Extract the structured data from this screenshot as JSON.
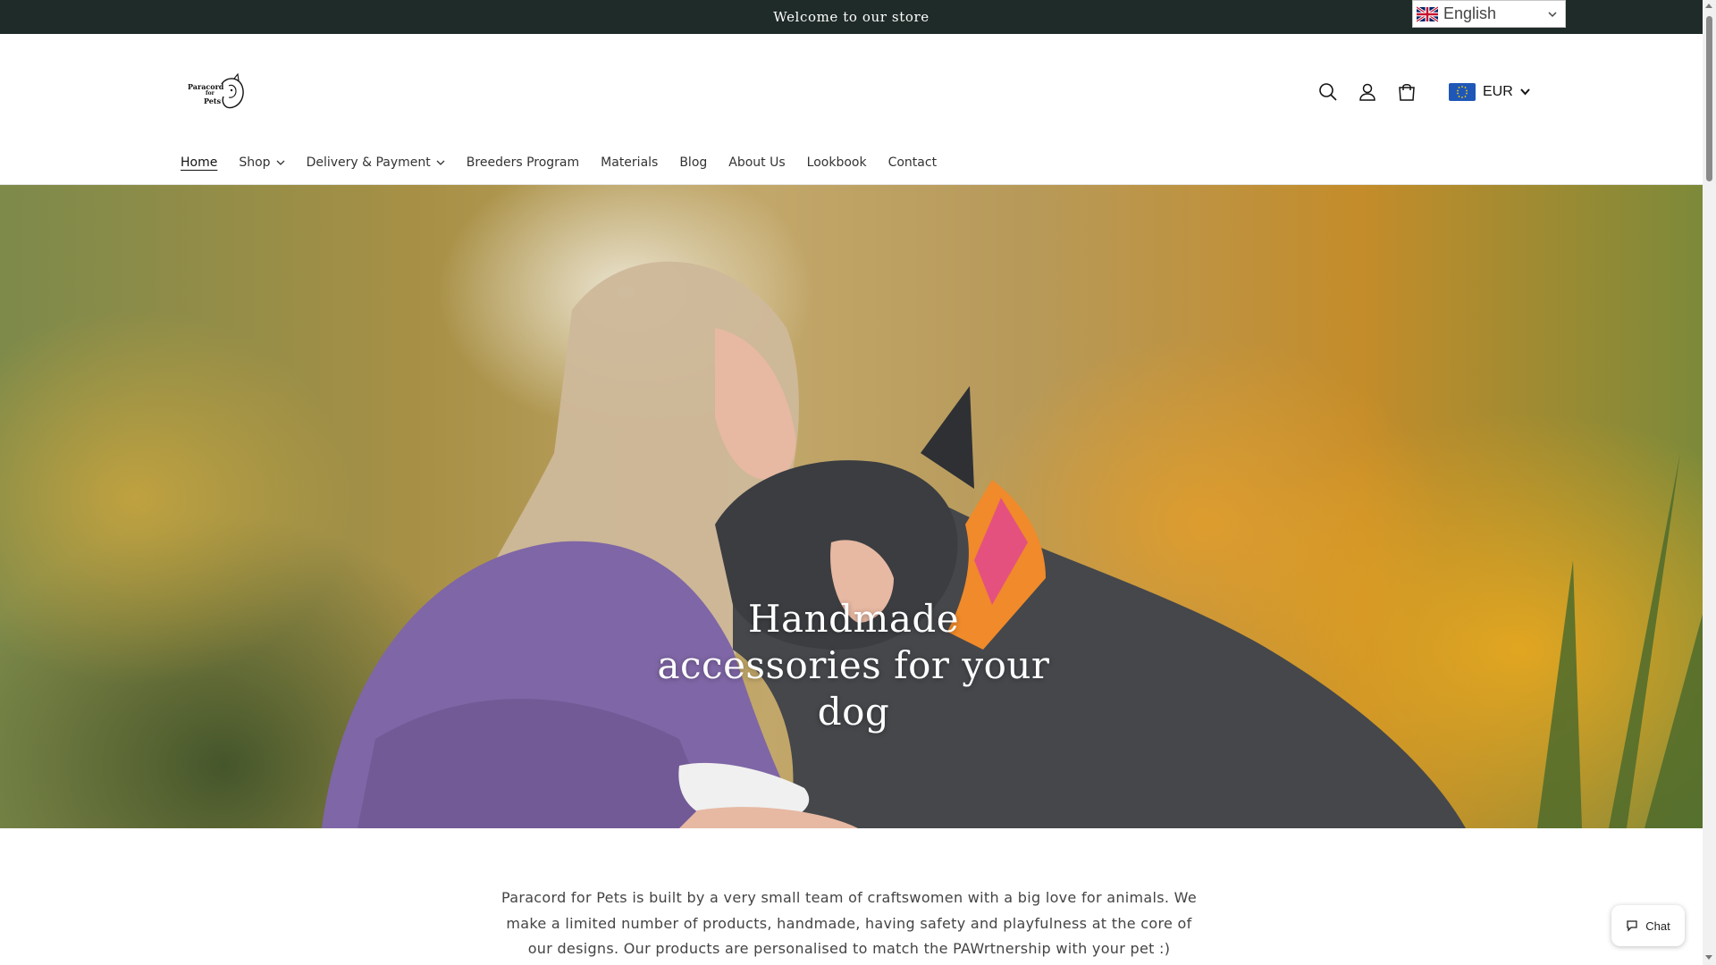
{
  "announcement": {
    "text": "Welcome to our store"
  },
  "language_selector": {
    "selected": "English",
    "flag_icon": "uk-flag-icon"
  },
  "header": {
    "logo": {
      "line1": "Paracord",
      "line2": "for",
      "line3": "Pets",
      "icon": "dog-head-logo-icon"
    },
    "icons": [
      "search-icon",
      "account-icon",
      "cart-icon"
    ],
    "currency": {
      "code": "EUR",
      "flag_icon": "eu-flag-icon"
    }
  },
  "nav": {
    "items": [
      {
        "label": "Home",
        "active": true,
        "dropdown": false
      },
      {
        "label": "Shop",
        "active": false,
        "dropdown": true
      },
      {
        "label": "Delivery & Payment",
        "active": false,
        "dropdown": true
      },
      {
        "label": "Breeders Program",
        "active": false,
        "dropdown": false
      },
      {
        "label": "Materials",
        "active": false,
        "dropdown": false
      },
      {
        "label": "Blog",
        "active": false,
        "dropdown": false
      },
      {
        "label": "About Us",
        "active": false,
        "dropdown": false
      },
      {
        "label": "Lookbook",
        "active": false,
        "dropdown": false
      },
      {
        "label": "Contact",
        "active": false,
        "dropdown": false
      }
    ]
  },
  "hero": {
    "title": "Handmade accessories for your dog"
  },
  "intro": {
    "text": "Paracord for Pets is built by a very small team of craftswomen with a big love for animals. We make a limited number of products, handmade, having safety and playfulness at the core of our designs. Our products are personalised to match the PAWrtnership with your pet :)"
  },
  "chat": {
    "label": "Chat",
    "icon": "chat-bubble-icon"
  },
  "colors": {
    "announcement_bg": "#1f2b28",
    "text": "#121212",
    "hero_text": "#ffffff"
  }
}
